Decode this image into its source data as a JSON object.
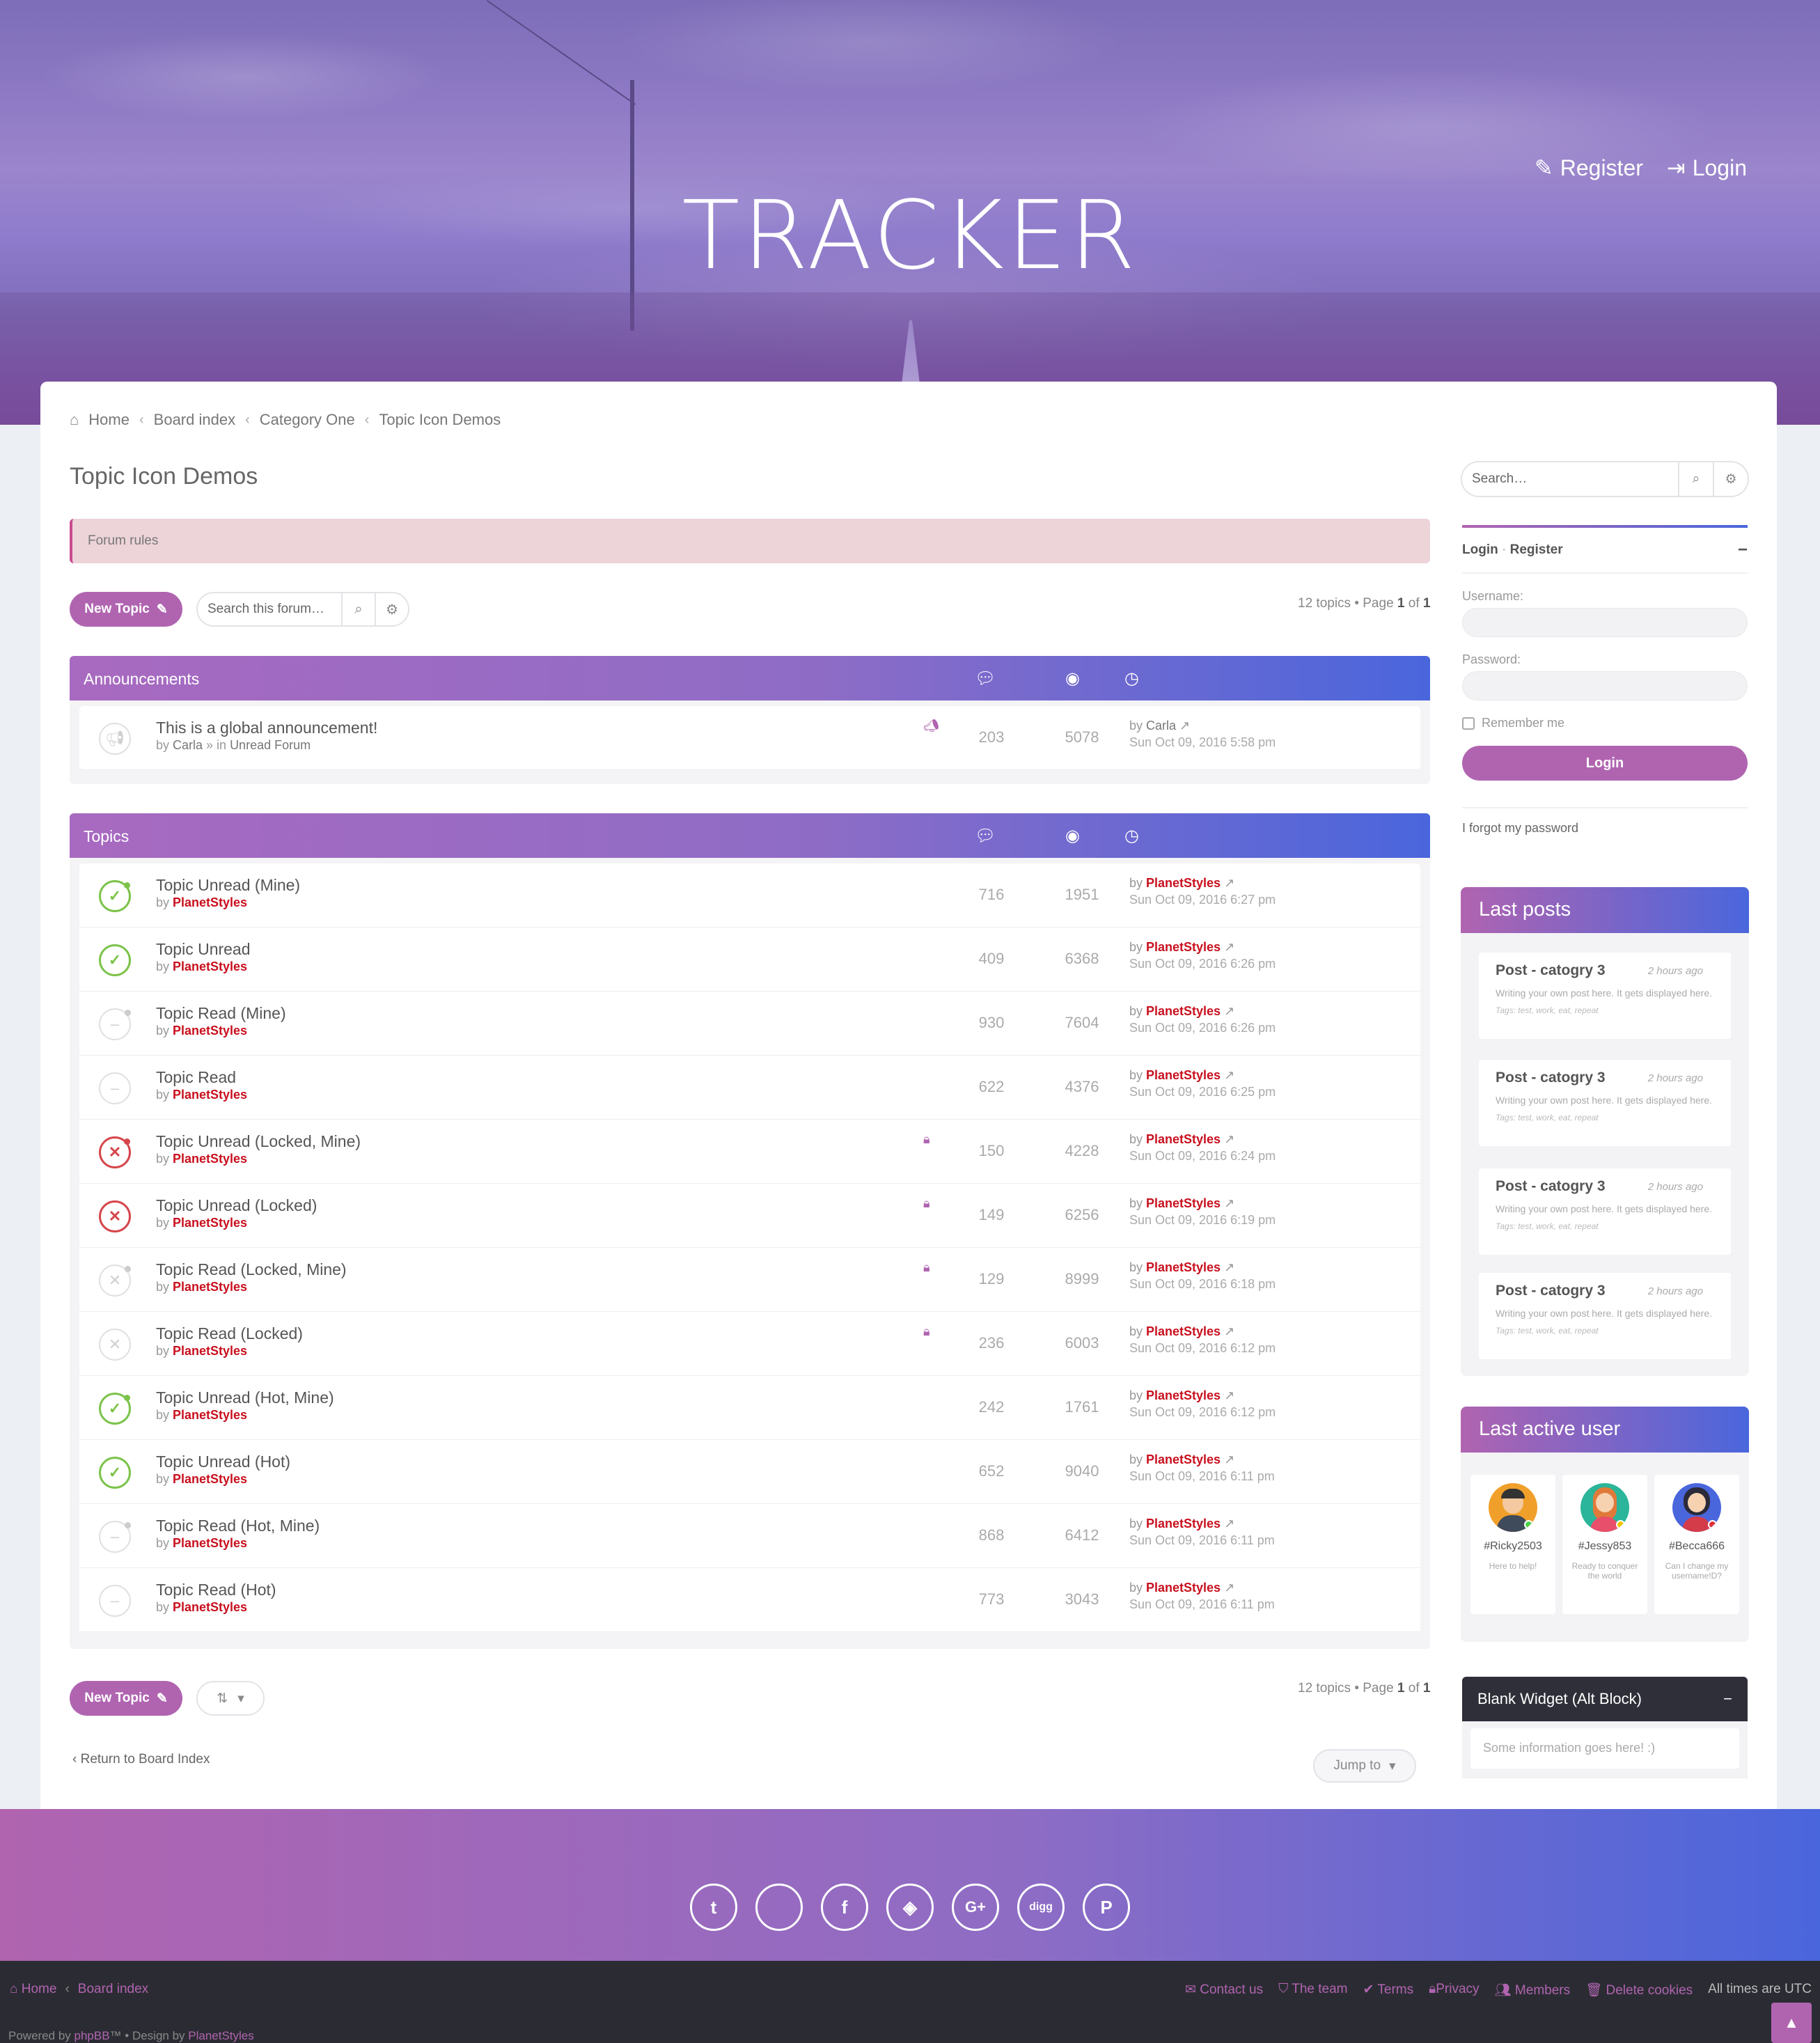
{
  "header": {
    "brand": "TRACKER",
    "register_label": "Register",
    "login_label": "Login"
  },
  "breadcrumb": [
    "Home",
    "Board index",
    "Category One",
    "Topic Icon Demos"
  ],
  "page": {
    "title": "Topic Icon Demos",
    "forum_rules": "Forum rules",
    "new_topic_label": "New Topic",
    "search_placeholder": "Search this forum…",
    "pagination_prefix": "12 topics • Page ",
    "page_current": "1",
    "page_of": " of ",
    "page_total": "1",
    "return_label": "Return to Board Index",
    "jump_to": "Jump to"
  },
  "announcements": {
    "heading": "Announcements",
    "items": [
      {
        "title": "This is a global announcement!",
        "author": "Carla",
        "forum_prefix": " » in ",
        "forum": "Unread Forum",
        "replies": "203",
        "views": "5078",
        "last_author": "Carla",
        "last_time": "Sun Oct 09, 2016 5:58 pm"
      }
    ]
  },
  "topics": {
    "heading": "Topics",
    "items": [
      {
        "title": "Topic Unread (Mine)",
        "author": "PlanetStyles",
        "replies": "716",
        "views": "1951",
        "last_author": "PlanetStyles",
        "last_time": "Sun Oct 09, 2016 6:27 pm",
        "state": "unread",
        "mine": true,
        "locked": false
      },
      {
        "title": "Topic Unread",
        "author": "PlanetStyles",
        "replies": "409",
        "views": "6368",
        "last_author": "PlanetStyles",
        "last_time": "Sun Oct 09, 2016 6:26 pm",
        "state": "unread",
        "mine": false,
        "locked": false
      },
      {
        "title": "Topic Read (Mine)",
        "author": "PlanetStyles",
        "replies": "930",
        "views": "7604",
        "last_author": "PlanetStyles",
        "last_time": "Sun Oct 09, 2016 6:26 pm",
        "state": "read",
        "mine": true,
        "locked": false
      },
      {
        "title": "Topic Read",
        "author": "PlanetStyles",
        "replies": "622",
        "views": "4376",
        "last_author": "PlanetStyles",
        "last_time": "Sun Oct 09, 2016 6:25 pm",
        "state": "read",
        "mine": false,
        "locked": false
      },
      {
        "title": "Topic Unread (Locked, Mine)",
        "author": "PlanetStyles",
        "replies": "150",
        "views": "4228",
        "last_author": "PlanetStyles",
        "last_time": "Sun Oct 09, 2016 6:24 pm",
        "state": "locked-unread",
        "mine": true,
        "locked": true
      },
      {
        "title": "Topic Unread (Locked)",
        "author": "PlanetStyles",
        "replies": "149",
        "views": "6256",
        "last_author": "PlanetStyles",
        "last_time": "Sun Oct 09, 2016 6:19 pm",
        "state": "locked-unread",
        "mine": false,
        "locked": true
      },
      {
        "title": "Topic Read (Locked, Mine)",
        "author": "PlanetStyles",
        "replies": "129",
        "views": "8999",
        "last_author": "PlanetStyles",
        "last_time": "Sun Oct 09, 2016 6:18 pm",
        "state": "locked-read",
        "mine": true,
        "locked": true
      },
      {
        "title": "Topic Read (Locked)",
        "author": "PlanetStyles",
        "replies": "236",
        "views": "6003",
        "last_author": "PlanetStyles",
        "last_time": "Sun Oct 09, 2016 6:12 pm",
        "state": "locked-read",
        "mine": false,
        "locked": true
      },
      {
        "title": "Topic Unread (Hot, Mine)",
        "author": "PlanetStyles",
        "replies": "242",
        "views": "1761",
        "last_author": "PlanetStyles",
        "last_time": "Sun Oct 09, 2016 6:12 pm",
        "state": "unread",
        "mine": true,
        "locked": false
      },
      {
        "title": "Topic Unread (Hot)",
        "author": "PlanetStyles",
        "replies": "652",
        "views": "9040",
        "last_author": "PlanetStyles",
        "last_time": "Sun Oct 09, 2016 6:11 pm",
        "state": "unread",
        "mine": false,
        "locked": false
      },
      {
        "title": "Topic Read (Hot, Mine)",
        "author": "PlanetStyles",
        "replies": "868",
        "views": "6412",
        "last_author": "PlanetStyles",
        "last_time": "Sun Oct 09, 2016 6:11 pm",
        "state": "read",
        "mine": true,
        "locked": false
      },
      {
        "title": "Topic Read (Hot)",
        "author": "PlanetStyles",
        "replies": "773",
        "views": "3043",
        "last_author": "PlanetStyles",
        "last_time": "Sun Oct 09, 2016 6:11 pm",
        "state": "read",
        "mine": false,
        "locked": false
      }
    ]
  },
  "sidebar": {
    "search_placeholder": "Search…",
    "login_tab": "Login",
    "register_tab": "Register",
    "username_label": "Username:",
    "password_label": "Password:",
    "remember_label": "Remember me",
    "login_button": "Login",
    "forgot_label": "I forgot my password",
    "last_posts_title": "Last posts",
    "posts": [
      {
        "title": "Post - catogry 3",
        "ago": "2 hours ago",
        "body": "Writing your own post here. It gets displayed here.",
        "tags": "Tags: test, work, eat, repeat"
      },
      {
        "title": "Post - catogry 3",
        "ago": "2 hours ago",
        "body": "Writing your own post here. It gets displayed here.",
        "tags": "Tags: test, work, eat, repeat"
      },
      {
        "title": "Post - catogry 3",
        "ago": "2 hours ago",
        "body": "Writing your own post here. It gets displayed here.",
        "tags": "Tags: test, work, eat, repeat"
      },
      {
        "title": "Post - catogry 3",
        "ago": "2 hours ago",
        "body": "Writing your own post here. It gets displayed here.",
        "tags": "Tags: test, work, eat, repeat"
      }
    ],
    "last_active_title": "Last active user",
    "users": [
      {
        "name": "#Ricky2503",
        "desc": "Here to help!",
        "status": "online"
      },
      {
        "name": "#Jessy853",
        "desc": "Ready to conquer the world",
        "status": "away"
      },
      {
        "name": "#Becca666",
        "desc": "Can I change my username!D?",
        "status": "busy"
      }
    ],
    "blank_title": "Blank Widget (Alt Block)",
    "blank_body": "Some information goes here! :)"
  },
  "footer": {
    "social": [
      "twitter-icon",
      "apple-icon",
      "facebook-icon",
      "codepen-icon",
      "google-plus-icon",
      "digg-icon",
      "pinterest-icon"
    ],
    "nav_left": [
      "Home",
      "Board index"
    ],
    "contact": "Contact us",
    "team": "The team",
    "terms": "Terms",
    "privacy": "Privacy",
    "members": "Members",
    "delete_cookies": "Delete cookies",
    "timezone": "All times are UTC",
    "powered_prefix": "Powered by ",
    "powered_link": "phpBB",
    "powered_mid": "™ • Design by ",
    "design_link": "PlanetStyles"
  },
  "colors": {
    "accent": "#b064b0",
    "gradient_end": "#4a66dc",
    "author_red": "#c8101e",
    "unread_green": "#7cc34a",
    "locked_red": "#d6464c"
  }
}
